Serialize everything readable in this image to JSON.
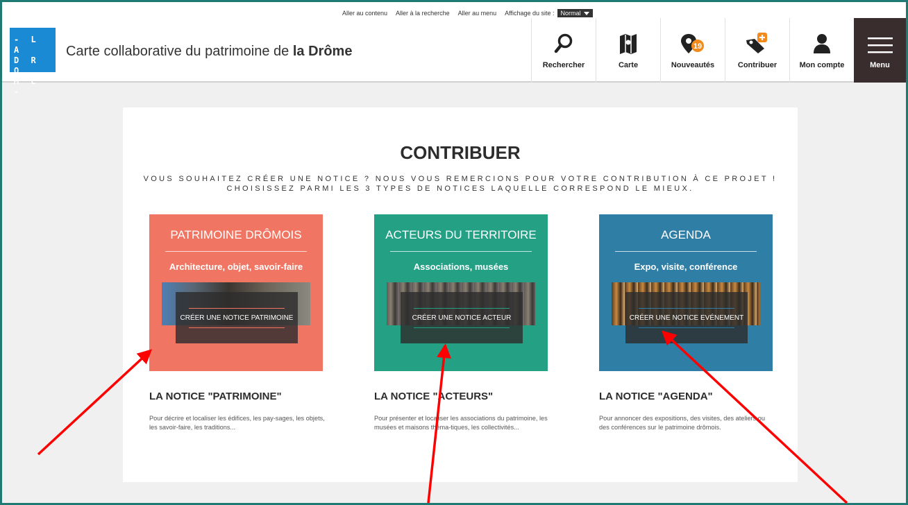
{
  "skip_links": [
    "Aller au contenu",
    "Aller à la recherche",
    "Aller au menu"
  ],
  "display": {
    "label": "Affichage du site :",
    "value": "Normal"
  },
  "logo": {
    "lines": [
      "- L A",
      "D R O",
      "M E -"
    ]
  },
  "site_title": {
    "prefix": "Carte collaborative du patrimoine de ",
    "bold": "la Drôme"
  },
  "nav": {
    "search": "Rechercher",
    "map": "Carte",
    "news": "Nouveautés",
    "news_count": "19",
    "contribute": "Contribuer",
    "account": "Mon compte",
    "menu": "Menu"
  },
  "main": {
    "title": "CONTRIBUER",
    "subtitle_line1": "VOUS SOUHAITEZ CRÉER UNE NOTICE ? NOUS VOUS REMERCIONS POUR VOTRE CONTRIBUTION À CE PROJET !",
    "subtitle_line2": "CHOISISSEZ PARMI LES 3 TYPES DE NOTICES LAQUELLE CORRESPOND LE MIEUX."
  },
  "cards": [
    {
      "title": "PATRIMOINE DRÔMOIS",
      "subtitle": "Architecture, objet, savoir-faire",
      "button": "CRÉER UNE NOTICE PATRIMOINE",
      "notice_title": "LA NOTICE \"PATRIMOINE\"",
      "notice_desc": "Pour décrire et localiser les édifices, les pay-sages, les objets, les savoir-faire, les traditions...",
      "color": "#f07663"
    },
    {
      "title": "ACTEURS DU TERRITOIRE",
      "subtitle": "Associations, musées",
      "button": "CRÉER UNE NOTICE ACTEUR",
      "notice_title": "LA NOTICE \"ACTEURS\"",
      "notice_desc": "Pour présenter et localiser les associations du patrimoine, les musées et maisons théma-tiques, les collectivités...",
      "color": "#24a085"
    },
    {
      "title": "AGENDA",
      "subtitle": "Expo, visite, conférence",
      "button": "CRÉER UNE NOTICE EVÉNEMENT",
      "notice_title": "LA NOTICE \"AGENDA\"",
      "notice_desc": "Pour annoncer des expositions, des visites, des ateliers ou des conférences sur le patrimoine drômois.",
      "color": "#2e7ea6"
    }
  ],
  "colors": {
    "frame": "#1f7a73",
    "logo": "#1a8ad4",
    "menu_bg": "#3a2d2d",
    "badge": "#f28a1c",
    "annotation_arrows": "#ff0000"
  }
}
